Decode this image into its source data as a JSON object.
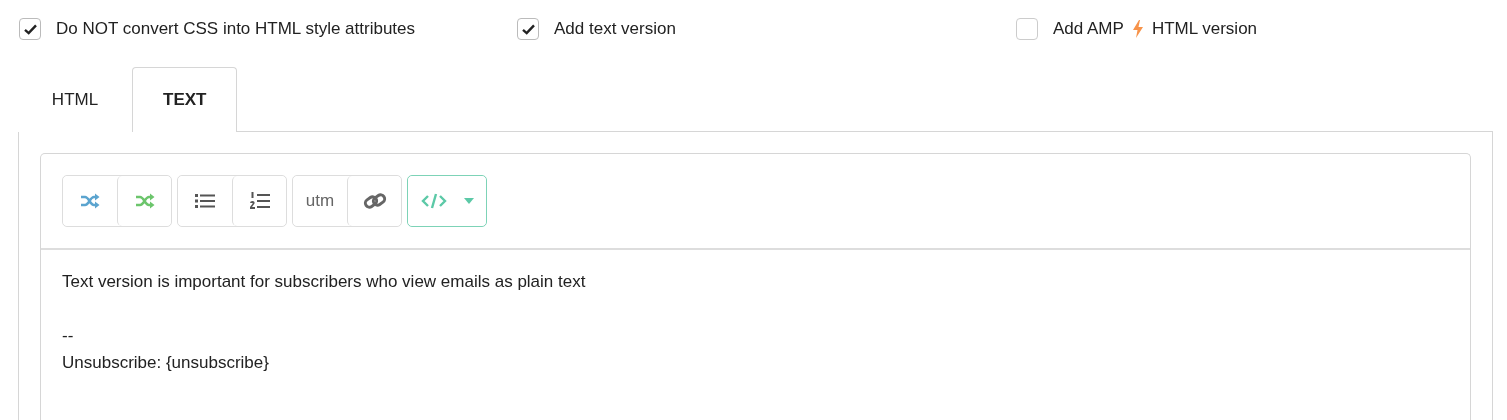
{
  "options": [
    {
      "label": "Do NOT convert CSS into HTML style attributes",
      "checked": true
    },
    {
      "label": "Add text version",
      "checked": true
    },
    {
      "label": "Add AMP",
      "label_after": "HTML version",
      "checked": false
    }
  ],
  "tabs": [
    {
      "label": "HTML",
      "selected": false
    },
    {
      "label": "TEXT",
      "selected": true
    }
  ],
  "toolbar": {
    "groups": [
      [
        {
          "kind": "shuffle",
          "color": "#5ba4cf"
        },
        {
          "kind": "shuffle",
          "color": "#6cc56c"
        }
      ],
      [
        {
          "kind": "bullet-list"
        },
        {
          "kind": "numbered-list"
        }
      ],
      [
        {
          "kind": "text",
          "label": "utm"
        },
        {
          "kind": "link"
        }
      ],
      [
        {
          "kind": "code-dropdown"
        }
      ]
    ]
  },
  "body": {
    "paragraphs": [
      [
        "Text version is important for subscribers who view emails as plain text"
      ],
      [
        "--",
        "Unsubscribe: {unsubscribe}"
      ]
    ]
  }
}
